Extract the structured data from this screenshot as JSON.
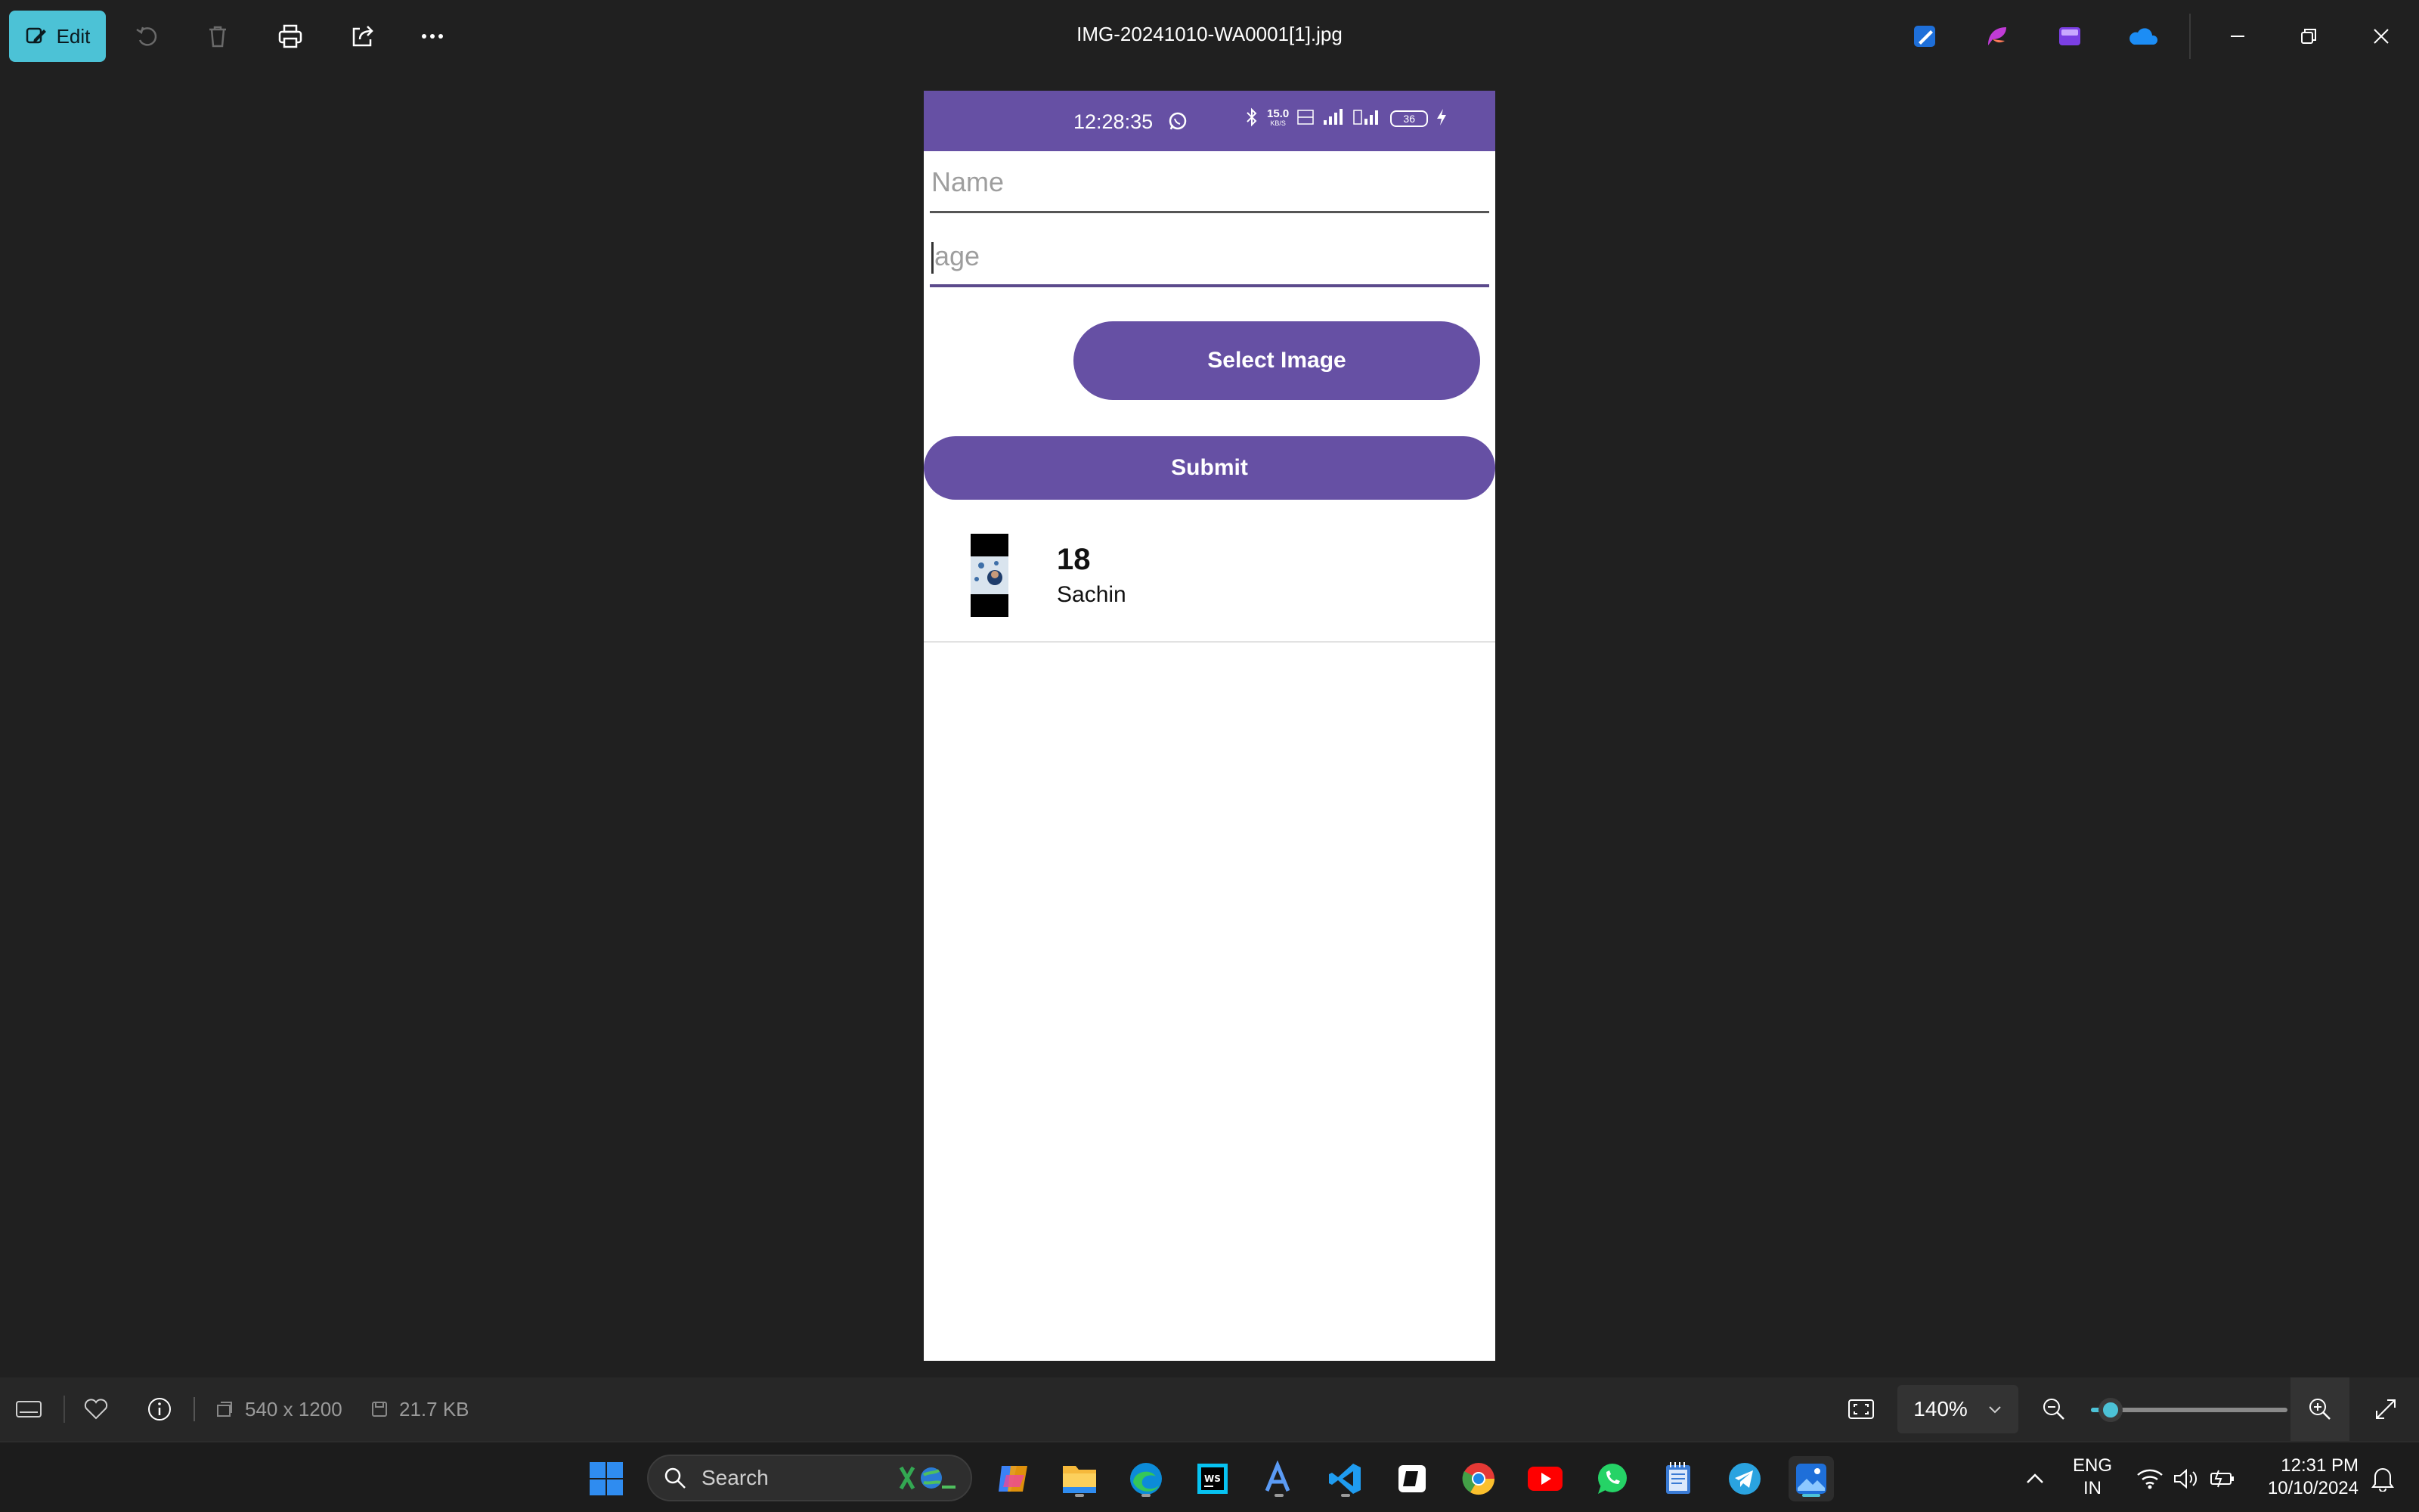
{
  "toolbar": {
    "edit_label": "Edit",
    "file_title": "IMG-20241010-WA0001[1].jpg",
    "icons": [
      "edit-icon",
      "rotate-icon",
      "delete-icon",
      "print-icon",
      "share-icon",
      "more-icon"
    ],
    "app_icons": [
      "photos-editor-icon",
      "clipchamp-icon",
      "designer-icon",
      "onedrive-icon"
    ],
    "window_controls": [
      "minimize-icon",
      "restore-icon",
      "close-icon"
    ]
  },
  "phone": {
    "status_bar": {
      "time": "12:28:35",
      "net_speed": "15.0",
      "net_unit": "KB/S",
      "battery": "36"
    },
    "form": {
      "name_placeholder": "Name",
      "age_placeholder": "age",
      "select_image_label": "Select Image",
      "submit_label": "Submit"
    },
    "list": [
      {
        "age": "18",
        "name": "Sachin"
      }
    ]
  },
  "info_bar": {
    "dimensions": "540 x 1200",
    "file_size": "21.7 KB",
    "zoom": "140%",
    "zoom_level_fraction": 0.1
  },
  "taskbar": {
    "search_placeholder": "Search",
    "apps": [
      "windows-start-icon",
      "copilot-icon",
      "file-explorer-icon",
      "edge-icon",
      "webstorm-icon",
      "translator-icon",
      "vscode-icon",
      "notion-icon",
      "chrome-icon",
      "youtube-icon",
      "whatsapp-icon",
      "notepad-icon",
      "telegram-icon",
      "photos-icon"
    ],
    "language_top": "ENG",
    "language_bottom": "IN",
    "time": "12:31 PM",
    "date": "10/10/2024"
  },
  "colors": {
    "accent": "#4cc2d6",
    "app_primary": "#6650a4",
    "background": "#202020"
  }
}
